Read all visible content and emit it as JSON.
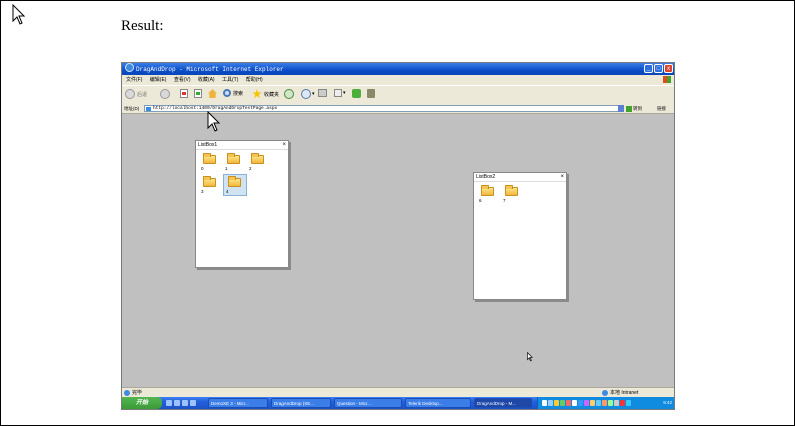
{
  "result_label": "Result:",
  "window": {
    "title": "DragAndDrop - Microsoft Internet Explorer",
    "menu": [
      "文件(F)",
      "编辑(E)",
      "查看(V)",
      "收藏(A)",
      "工具(T)",
      "帮助(H)"
    ],
    "toolbar": {
      "back": "后退",
      "search": "搜索",
      "favorites": "收藏夹"
    },
    "address": {
      "label": "地址(D)",
      "url": "http://localhost:1400/DragAndDropTestPage.aspx",
      "go": "转到",
      "links": "链接"
    },
    "status": {
      "left": "完毕",
      "zone": "本地 Intranet"
    }
  },
  "listboxes": [
    {
      "title": "ListBox1",
      "items": [
        {
          "label": "0",
          "selected": false
        },
        {
          "label": "1",
          "selected": false
        },
        {
          "label": "2",
          "selected": false
        },
        {
          "label": "3",
          "selected": false
        },
        {
          "label": "4",
          "selected": true
        }
      ]
    },
    {
      "title": "ListBox2",
      "items": [
        {
          "label": "6",
          "selected": false
        },
        {
          "label": "7",
          "selected": false
        }
      ]
    }
  ],
  "close_glyph": "×",
  "taskbar": {
    "start": "开始",
    "tasks": [
      {
        "label": "DemoXE 3 - Micr...",
        "active": false
      },
      {
        "label": "DragAndDrop (XE...",
        "active": false
      },
      {
        "label": "Question - Micr...",
        "active": false
      },
      {
        "label": "Telerik Desktop...",
        "active": false
      },
      {
        "label": "DragAndDrop - M...",
        "active": true
      }
    ],
    "time": "9:42"
  },
  "colors": {
    "taskbar": "#245edb",
    "start": "#3a9a36",
    "content_bg": "#c0c0c0",
    "folder": "#f2b73c"
  }
}
